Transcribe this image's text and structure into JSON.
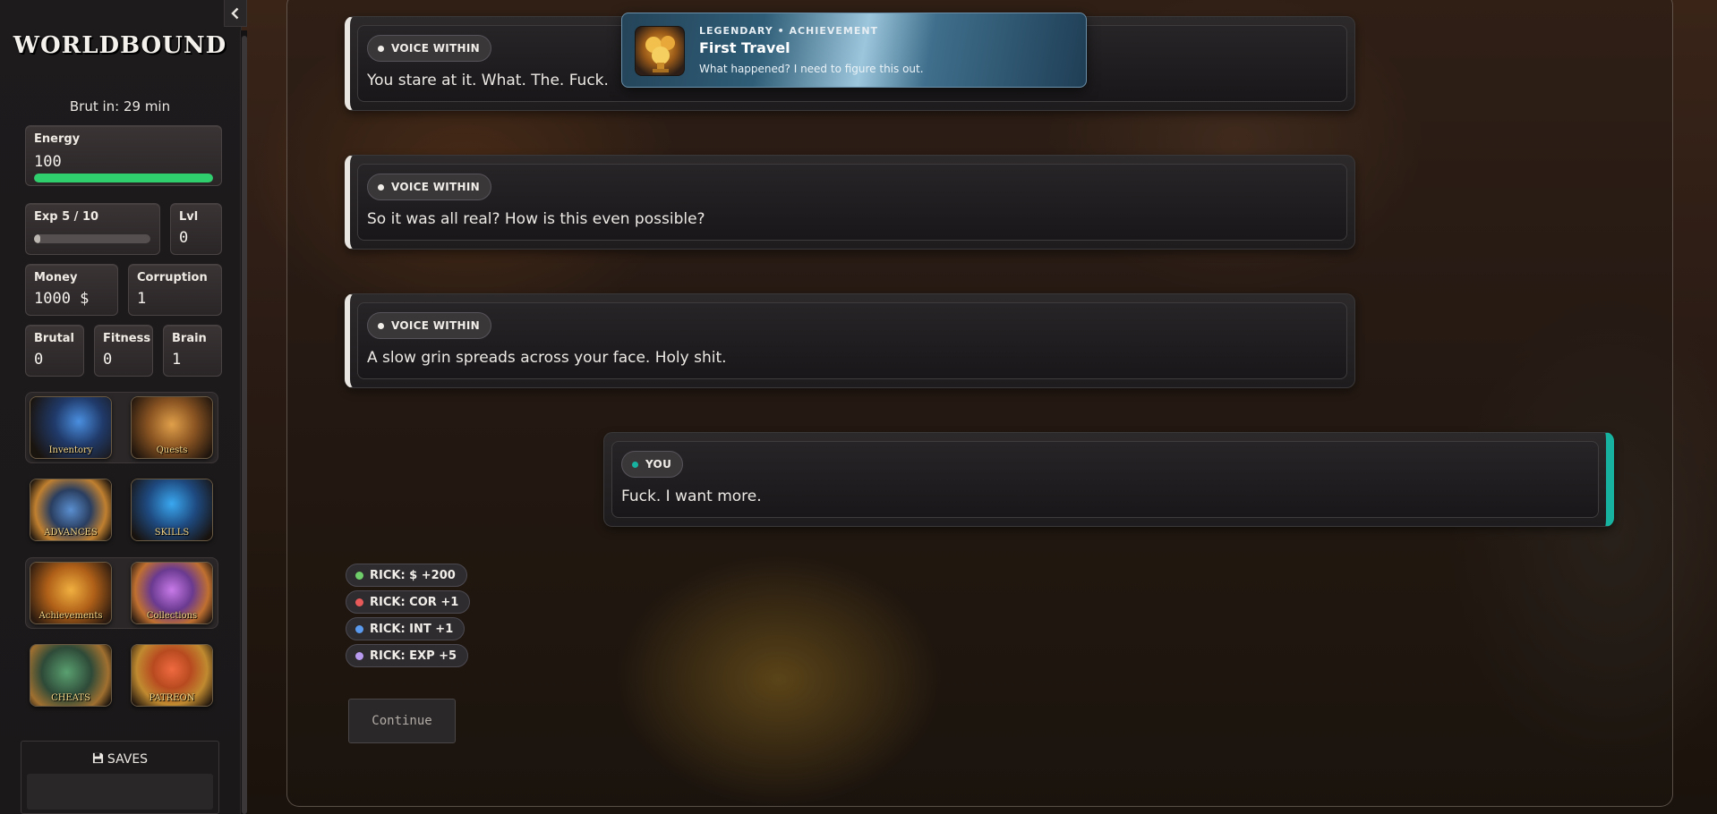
{
  "sidebar": {
    "logo": "WORLDBOUND",
    "timer": "Brut in: 29 min",
    "energy": {
      "label": "Energy",
      "value": "100",
      "fraction": 1.0,
      "color": "#2fcf6e"
    },
    "exp": {
      "label": "Exp 5 / 10",
      "fraction": 0.05
    },
    "lvl": {
      "label": "Lvl",
      "value": "0"
    },
    "money": {
      "label": "Money",
      "value": "1000 $"
    },
    "corruption": {
      "label": "Corruption",
      "value": "1"
    },
    "brutal": {
      "label": "Brutal",
      "value": "0"
    },
    "fitness": {
      "label": "Fitness",
      "value": "0"
    },
    "brain": {
      "label": "Brain",
      "value": "1"
    },
    "menu": [
      {
        "label": "Inventory",
        "icon": "inventory-icon"
      },
      {
        "label": "Quests",
        "icon": "quests-icon"
      },
      {
        "label": "ADVANCES",
        "icon": "advances-icon"
      },
      {
        "label": "SKILLS",
        "icon": "skills-icon"
      },
      {
        "label": "Achievements",
        "icon": "achievements-icon"
      },
      {
        "label": "Collections",
        "icon": "collections-icon"
      },
      {
        "label": "CHEATS",
        "icon": "cheats-icon"
      },
      {
        "label": "PATREON",
        "icon": "patreon-icon"
      }
    ],
    "saves_label": "SAVES"
  },
  "messages": [
    {
      "speaker": "VOICE WITHIN",
      "text": "You stare at it. What. The. Fuck."
    },
    {
      "speaker": "VOICE WITHIN",
      "text": "So it was all real? How is this even possible?"
    },
    {
      "speaker": "VOICE WITHIN",
      "text": "A slow grin spreads across your face. Holy shit."
    },
    {
      "speaker": "YOU",
      "text": "Fuck. I want more."
    }
  ],
  "effects": [
    {
      "text": "RICK: $ +200",
      "color": "#6fce6a"
    },
    {
      "text": "RICK: COR +1",
      "color": "#e85a5a"
    },
    {
      "text": "RICK: INT +1",
      "color": "#5a9aef"
    },
    {
      "text": "RICK: EXP +5",
      "color": "#b89af0"
    }
  ],
  "continue_label": "Continue",
  "toast": {
    "kicker": "LEGENDARY • ACHIEVEMENT",
    "title": "First Travel",
    "description": "What happened? I need to figure this out."
  },
  "colors": {
    "voice_accent": "#e9e6e2",
    "you_accent": "#18b3a0"
  }
}
